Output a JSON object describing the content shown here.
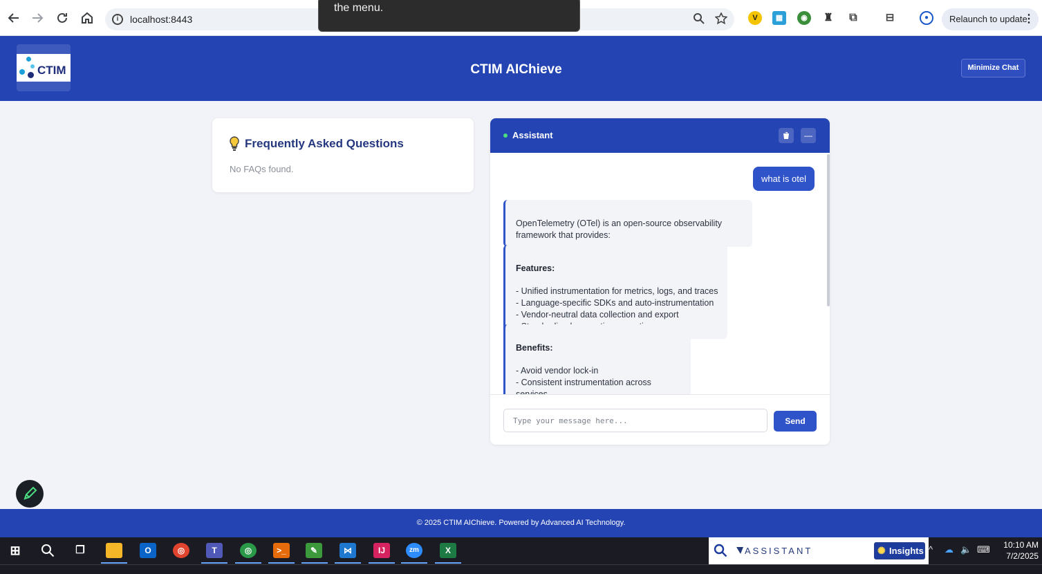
{
  "browser": {
    "url": "localhost:8443",
    "relaunch_label": "Relaunch to update",
    "toast_text": "the menu.",
    "status_url": "https://bitbucket.tccorp.../enter07.../images/...(RI/HOPL)/crpt/.../feature/test/..."
  },
  "header": {
    "logo_text": "CTIM",
    "title": "CTIM AIChieve",
    "minimize_label": "Minimize Chat"
  },
  "faq": {
    "title": "Frequently Asked Questions",
    "empty_text": "No FAQs found."
  },
  "chat": {
    "title": "Assistant",
    "user_message": "what is otel",
    "bot_messages": [
      {
        "heading": "",
        "body": "OpenTelemetry (OTel) is an open-source observability\nframework that provides:"
      },
      {
        "heading": "Features:",
        "body": "- Unified instrumentation for metrics, logs, and traces\n- Language-specific SDKs and auto-instrumentation\n- Vendor-neutral data collection and export\n- Standardized semantic conventions"
      },
      {
        "heading": "Benefits:",
        "body": "- Avoid vendor lock-in\n- Consistent instrumentation across services\n- Community-driven development\n- Support for multiple backends"
      }
    ],
    "input_placeholder": "Type your message here...",
    "send_label": "Send"
  },
  "footer": {
    "text": "© 2025 CTIM AIChieve. Powered by Advanced AI Technology."
  },
  "taskbar": {
    "assistant_label": "ASSISTANT",
    "insights_label": "Insights",
    "time": "10:10 AM",
    "date": "7/2/2025"
  },
  "colors": {
    "brand_blue": "#2444b4",
    "accent_blue": "#2f53c8",
    "status_green": "#4ade80"
  }
}
